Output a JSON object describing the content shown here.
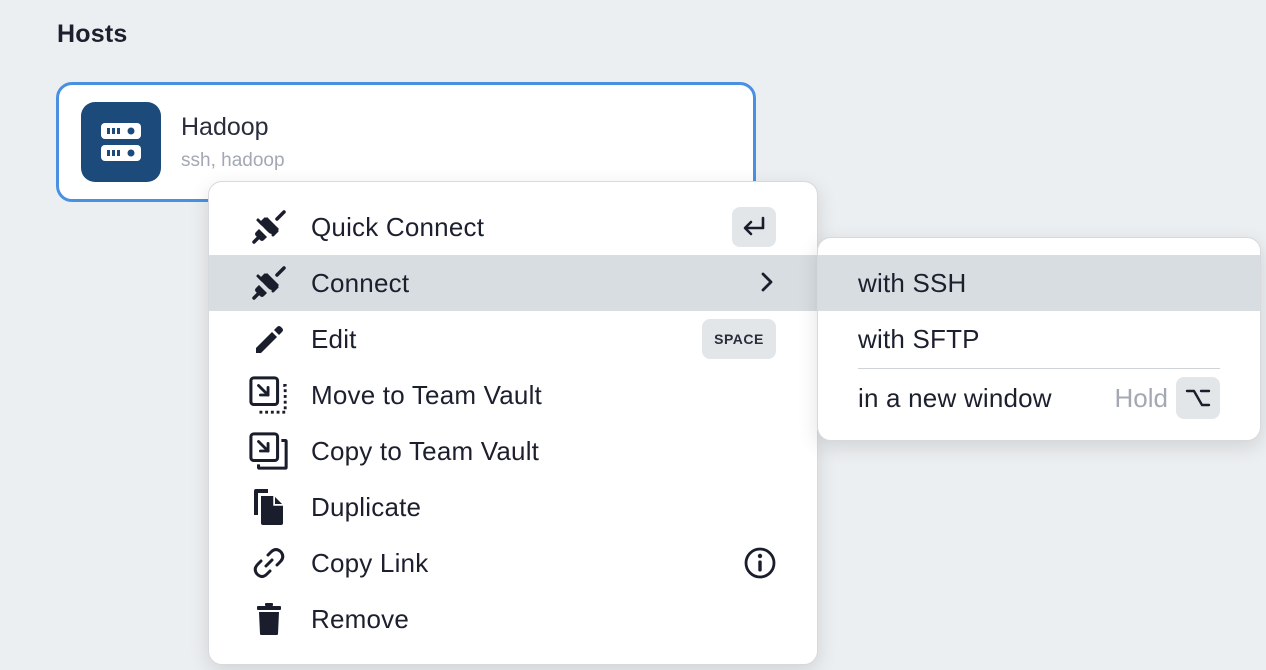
{
  "section": {
    "title": "Hosts"
  },
  "host": {
    "name": "Hadoop",
    "subtitle": "ssh, hadoop",
    "icon": "server-icon",
    "avatar_color": "#1b4a7b",
    "selected_border_color": "#4a90e2"
  },
  "context_menu": {
    "items": [
      {
        "label": "Quick Connect",
        "icon": "plug-icon",
        "shortcut": "enter-key"
      },
      {
        "label": "Connect",
        "icon": "plug-icon",
        "has_submenu": true,
        "active": true
      },
      {
        "label": "Edit",
        "icon": "pencil-icon",
        "shortcut": "SPACE"
      },
      {
        "label": "Move to Team Vault",
        "icon": "move-vault-icon"
      },
      {
        "label": "Copy to Team Vault",
        "icon": "copy-vault-icon"
      },
      {
        "label": "Duplicate",
        "icon": "duplicate-icon"
      },
      {
        "label": "Copy Link",
        "icon": "link-icon",
        "trailing_icon": "info-icon"
      },
      {
        "label": "Remove",
        "icon": "trash-icon"
      }
    ]
  },
  "submenu": {
    "items": [
      {
        "label": "with SSH",
        "active": true
      },
      {
        "label": "with SFTP"
      },
      {
        "label": "in a new window",
        "hint": "Hold",
        "shortcut": "option-key"
      }
    ]
  },
  "colors": {
    "background": "#eceff1",
    "menu_hover": "#d8dde1",
    "kbd_background": "#e3e6e9"
  }
}
